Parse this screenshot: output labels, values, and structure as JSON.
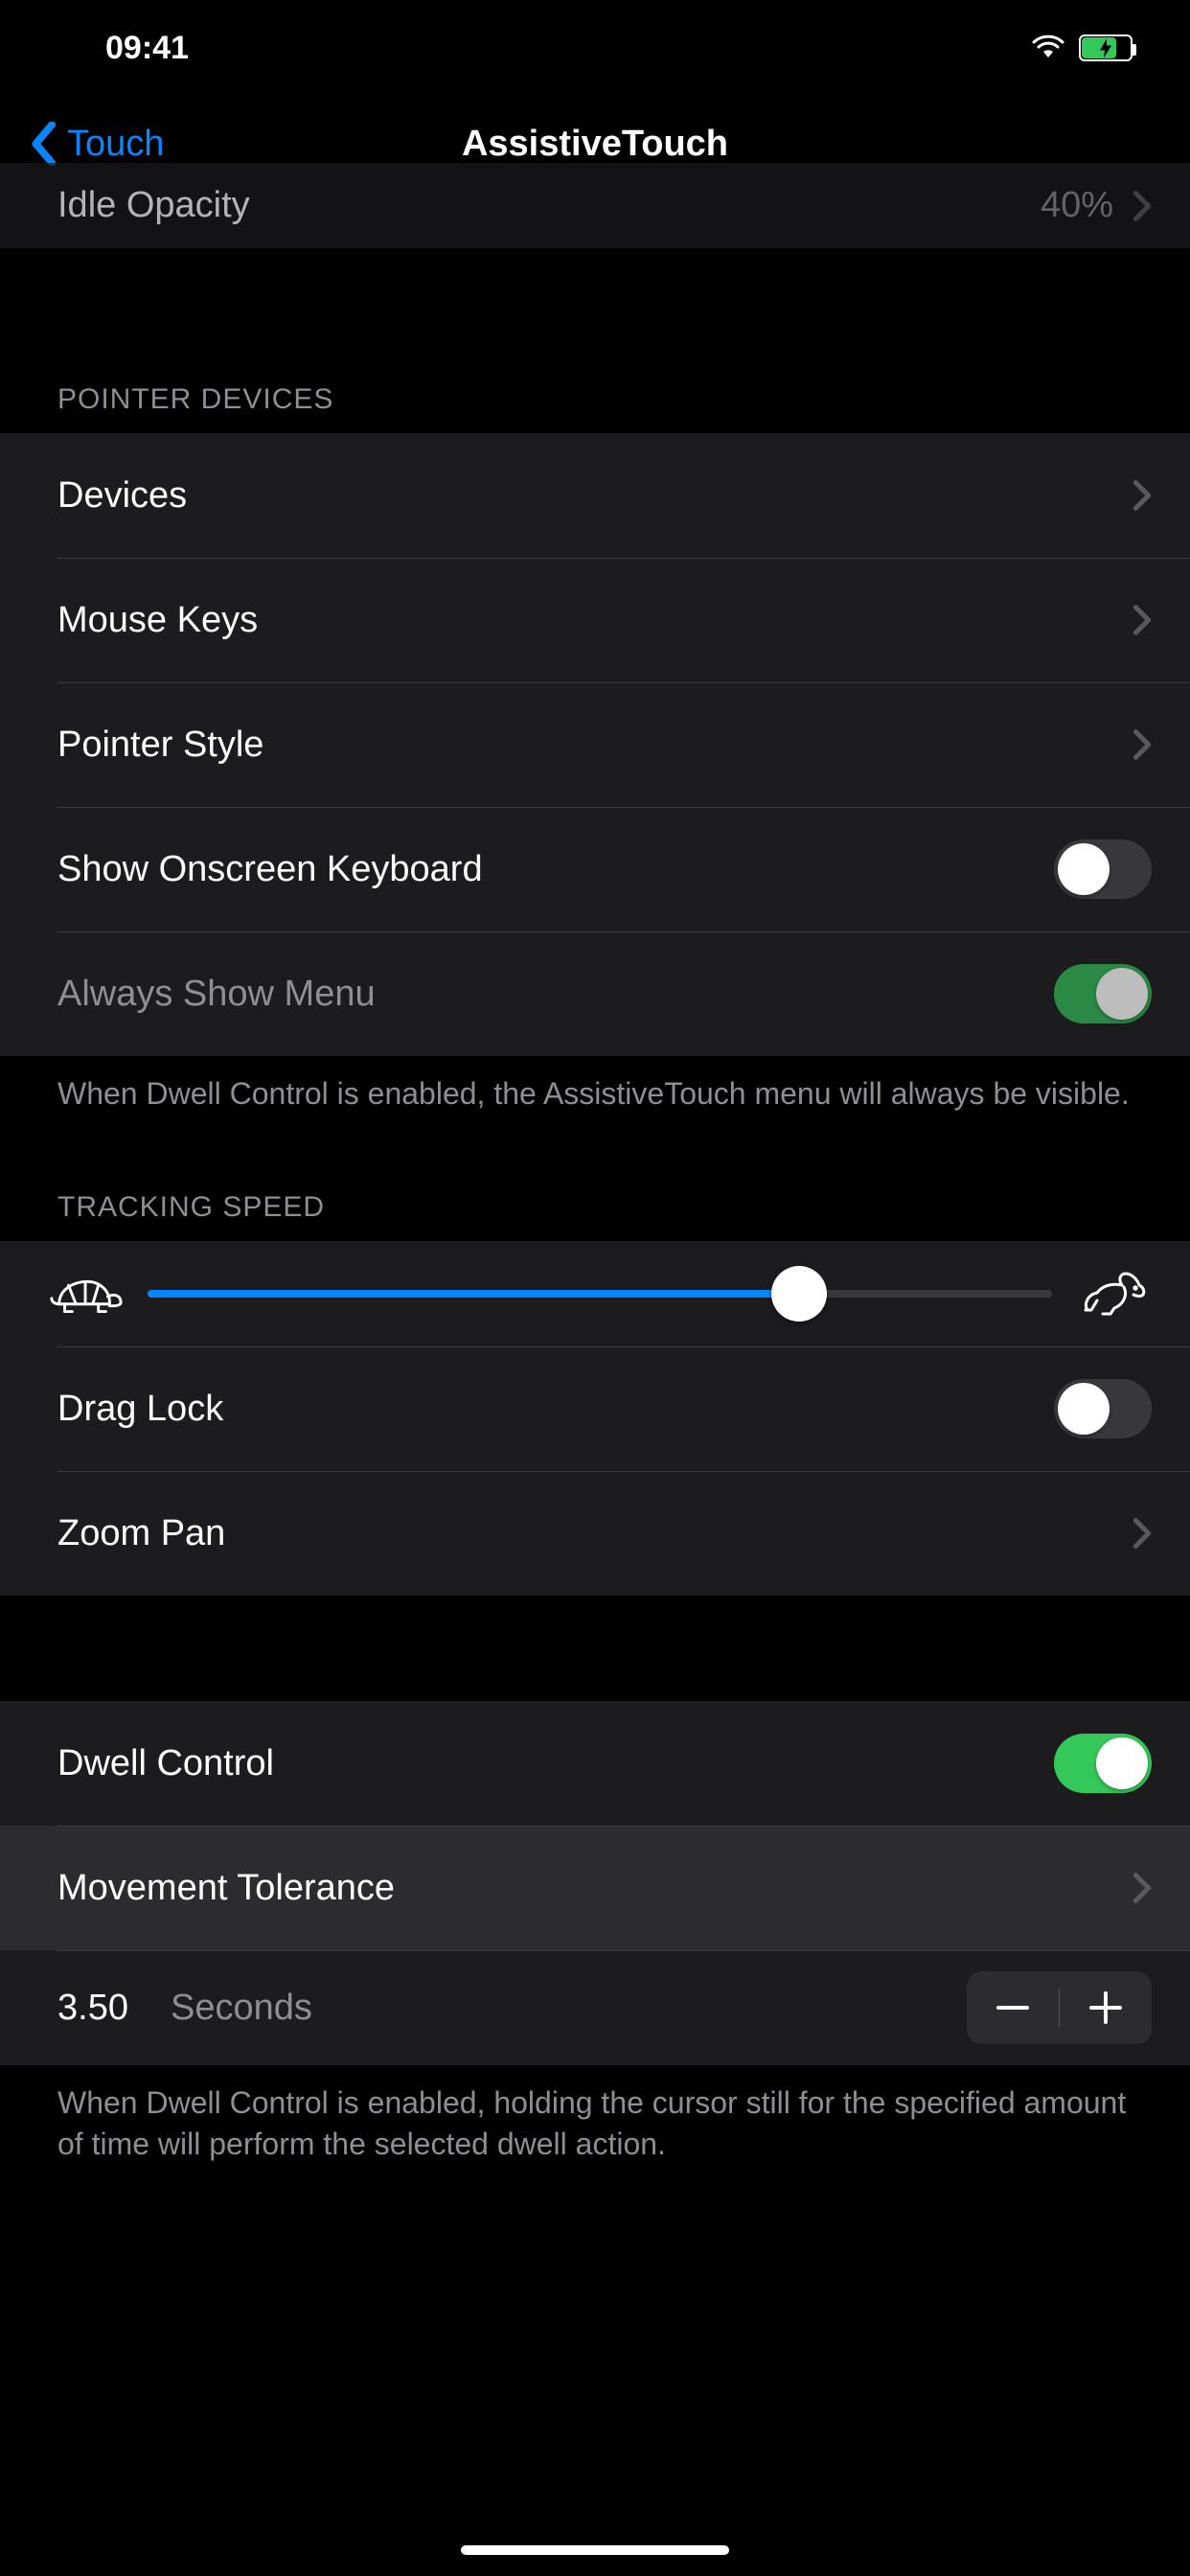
{
  "status": {
    "time": "09:41"
  },
  "nav": {
    "back_label": "Touch",
    "title": "AssistiveTouch"
  },
  "peek_row": {
    "label": "Idle Opacity",
    "value": "40%"
  },
  "sections": {
    "pointer_devices": {
      "header": "POINTER DEVICES",
      "rows": {
        "devices": "Devices",
        "mouse_keys": "Mouse Keys",
        "pointer_style": "Pointer Style",
        "show_onscreen_keyboard": "Show Onscreen Keyboard",
        "always_show_menu": "Always Show Menu"
      },
      "toggles": {
        "show_onscreen_keyboard": false,
        "always_show_menu": true
      },
      "footer": "When Dwell Control is enabled, the AssistiveTouch menu will always be visible."
    },
    "tracking_speed": {
      "header": "TRACKING SPEED",
      "slider_value_pct": 72,
      "rows": {
        "drag_lock": "Drag Lock",
        "zoom_pan": "Zoom Pan"
      },
      "toggles": {
        "drag_lock": false
      }
    },
    "dwell": {
      "rows": {
        "dwell_control": "Dwell Control",
        "movement_tolerance": "Movement Tolerance"
      },
      "toggles": {
        "dwell_control": true
      },
      "time_value": "3.50",
      "time_unit": "Seconds",
      "footer": "When Dwell Control is enabled, holding the cursor still for the specified amount of time will perform the selected dwell action."
    }
  }
}
